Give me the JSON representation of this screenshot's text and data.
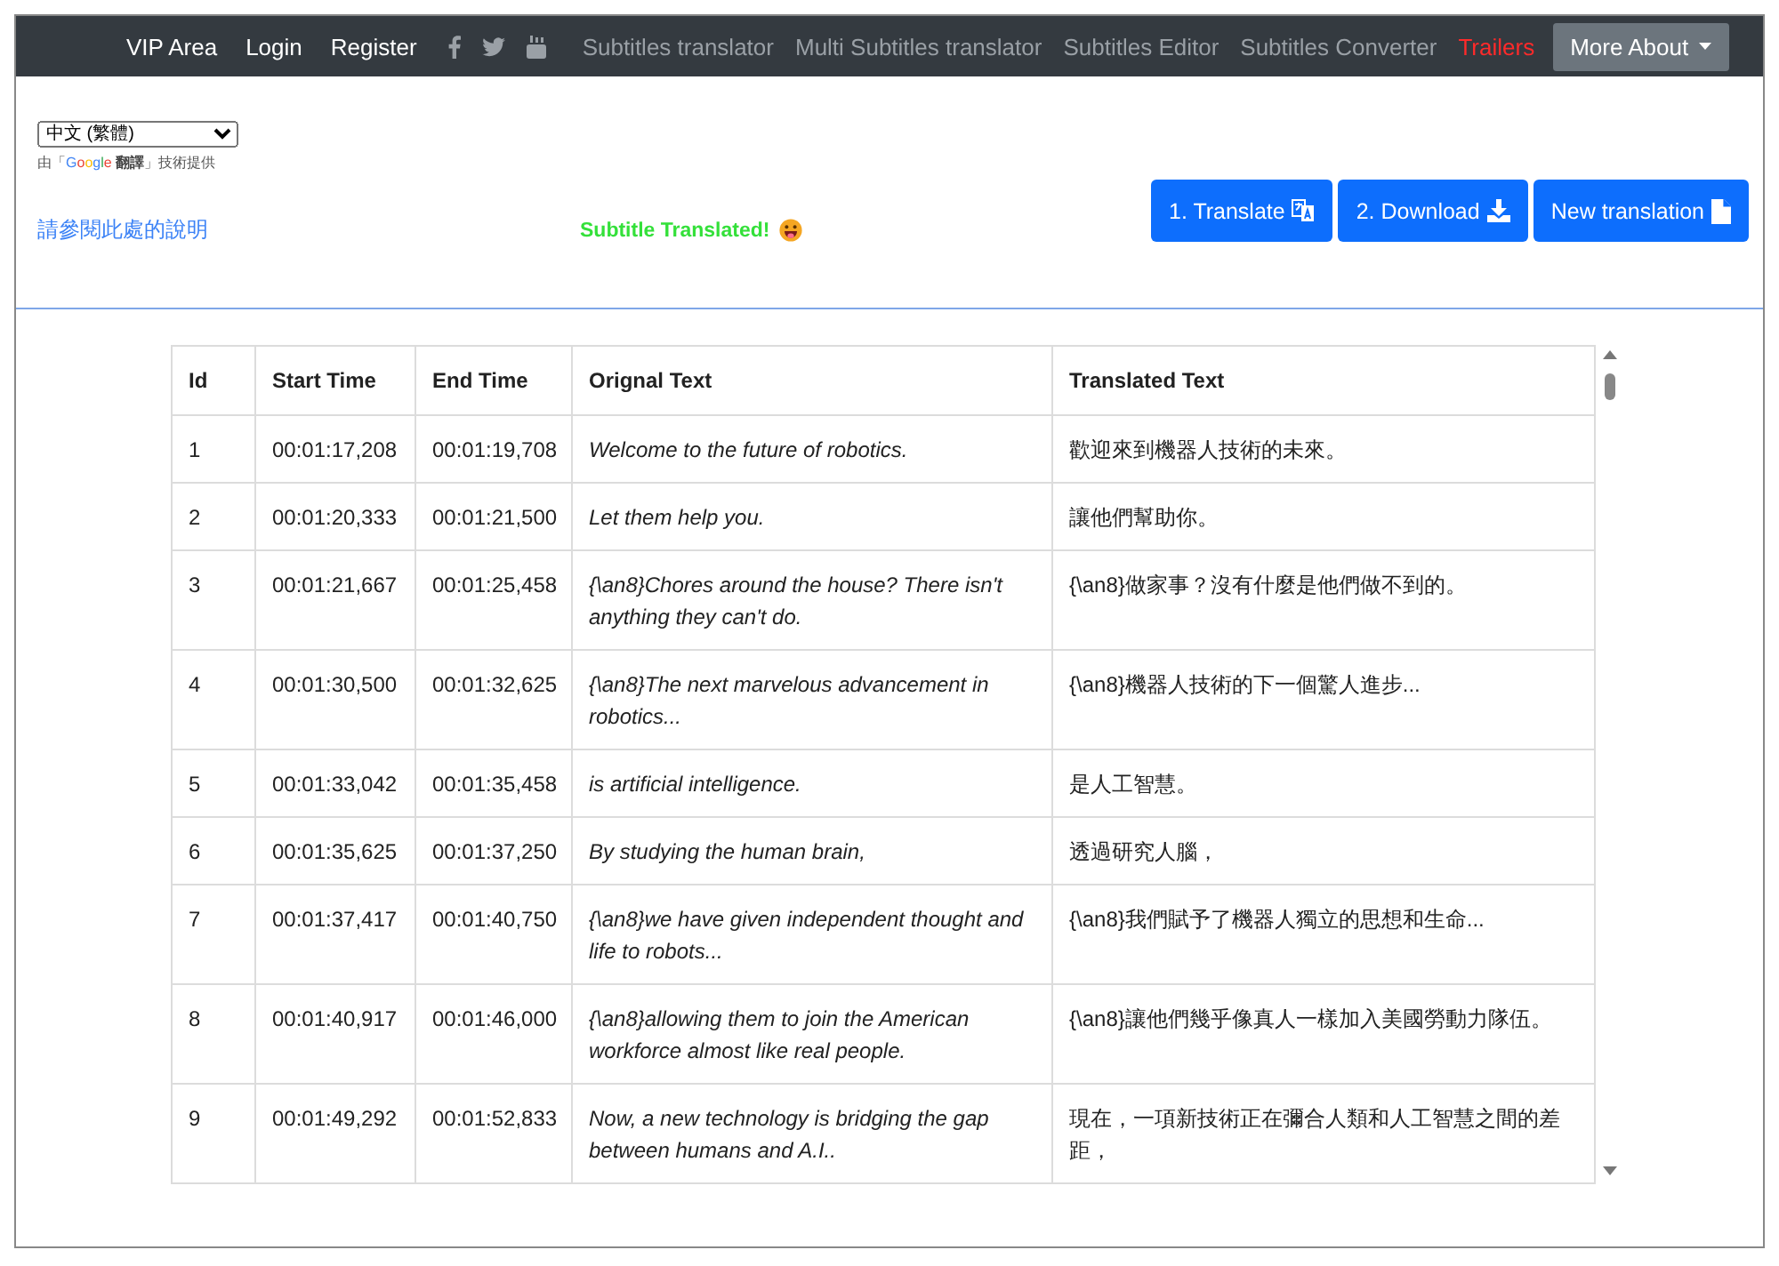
{
  "navbar": {
    "links": [
      {
        "label": "VIP Area",
        "kind": "primary"
      },
      {
        "label": "Login",
        "kind": "primary"
      },
      {
        "label": "Register",
        "kind": "primary"
      }
    ],
    "social": [
      {
        "kind": "facebook"
      },
      {
        "kind": "twitter"
      },
      {
        "kind": "youtube"
      }
    ],
    "tools": [
      {
        "label": "Subtitles translator",
        "kind": "muted"
      },
      {
        "label": "Multi Subtitles translator",
        "kind": "muted"
      },
      {
        "label": "Subtitles Editor",
        "kind": "muted"
      },
      {
        "label": "Subtitles Converter",
        "kind": "muted"
      },
      {
        "label": "Trailers",
        "kind": "highlight"
      }
    ],
    "dropdown": {
      "label": "More About"
    }
  },
  "language": {
    "value": "中文 (繁體)",
    "credit_prefix": "由「",
    "credit_brand": "Google",
    "credit_product": "翻譯",
    "credit_suffix": "」技術提供"
  },
  "help_link": "請參閱此處的說明",
  "status": "Subtitle Translated!",
  "buttons": [
    {
      "label": "1. Translate",
      "kind": "translate"
    },
    {
      "label": "2. Download",
      "kind": "download"
    },
    {
      "label": "New translation",
      "kind": "file"
    }
  ],
  "table": {
    "columns": [
      "Id",
      "Start Time",
      "End Time",
      "Orignal Text",
      "Translated Text"
    ],
    "rows": [
      [
        "1",
        "00:01:17,208",
        "00:01:19,708",
        "Welcome to the future of robotics.",
        "歡迎來到機器人技術的未來。"
      ],
      [
        "2",
        "00:01:20,333",
        "00:01:21,500",
        "Let them help you.",
        "讓他們幫助你。"
      ],
      [
        "3",
        "00:01:21,667",
        "00:01:25,458",
        "{\\an8}Chores around the house? There isn't anything they can't do.",
        "{\\an8}做家事？沒有什麼是他們做不到的。"
      ],
      [
        "4",
        "00:01:30,500",
        "00:01:32,625",
        "{\\an8}The next marvelous advancement in robotics...",
        "{\\an8}機器人技術的下一個驚人進步..."
      ],
      [
        "5",
        "00:01:33,042",
        "00:01:35,458",
        "is artificial intelligence.",
        "是人工智慧。"
      ],
      [
        "6",
        "00:01:35,625",
        "00:01:37,250",
        "By studying the human brain,",
        "透過研究人腦，"
      ],
      [
        "7",
        "00:01:37,417",
        "00:01:40,750",
        "{\\an8}we have given independent thought and life to robots...",
        "{\\an8}我們賦予了機器人獨立的思想和生命..."
      ],
      [
        "8",
        "00:01:40,917",
        "00:01:46,000",
        "{\\an8}allowing them to join the American workforce almost like real people.",
        "{\\an8}讓他們幾乎像真人一樣加入美國勞動力隊伍。"
      ],
      [
        "9",
        "00:01:49,292",
        "00:01:52,833",
        "Now, a new technology is bridging the gap between humans and A.I..",
        "現在，一項新技術正在彌合人類和人工智慧之間的差距，"
      ]
    ]
  }
}
